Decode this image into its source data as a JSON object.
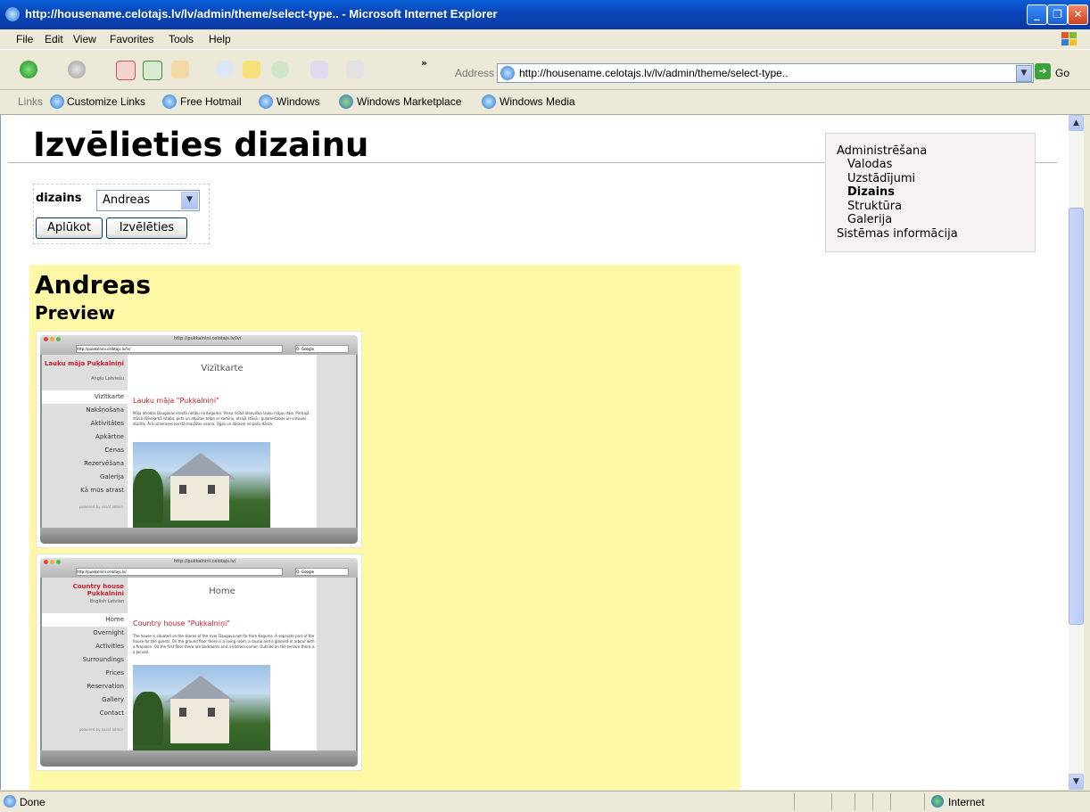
{
  "window": {
    "title": "http://housename.celotajs.lv/lv/admin/theme/select-type.. - Microsoft Internet Explorer"
  },
  "menu": {
    "items": [
      "File",
      "Edit",
      "View",
      "Favorites",
      "Tools",
      "Help"
    ]
  },
  "toolbar": {
    "address_label": "Address",
    "url": "http://housename.celotajs.lv/lv/admin/theme/select-type..",
    "go_label": "Go"
  },
  "links_bar": {
    "label": "Links",
    "items": [
      "Customize Links",
      "Free Hotmail",
      "Windows",
      "Windows Marketplace",
      "Windows Media"
    ]
  },
  "page": {
    "title": "Izvēlieties dizainu",
    "form": {
      "label": "dizains",
      "selected": "Andreas",
      "apply_label": "Aplūkot",
      "choose_label": "Izvēlēties"
    },
    "sidenav": {
      "items": [
        "Administrēšana",
        "Valodas",
        "Uzstādījumi",
        "Dizains",
        "Struktūra",
        "Galerija",
        "Sistēmas informācija"
      ],
      "active": "Dizains"
    },
    "theme": {
      "name": "Andreas",
      "preview_label": "Preview",
      "previews": [
        {
          "browser_url": "http://pukkalnini.celotajs.lv/lv/",
          "address": "http://pukkalnini.celotajs.lv/lv/",
          "search_placeholder": "Q- Google",
          "brand": "Lauku māja Puķkalniņi",
          "langs": "Angļu  Latviešu",
          "nav": [
            "Vizītkarte",
            "Nakšņošana",
            "Aktivitātes",
            "Apkārtne",
            "Cenas",
            "Rezervēšana",
            "Galerija",
            "Kā mūs atrast"
          ],
          "powered": "powered by sosof admin",
          "page_title": "Vizītkarte",
          "heading": "Lauku māja \"Puķkalniņi\"",
          "body": "Māja atrodas Daugavas krastā netālu no Ķeguma. Viesu rīcībā atsevišķa lauku mājas daļa. Pirmajā stāvā dzīvojamā istaba, pirts un atpūtas telpa ar kamīnu, otrajā stāvā - guļamistabas un virtuves stūrītis. Ārā uz terases karstā masāžas vanna. Ogas un dārzeņi no pašu dārza."
        },
        {
          "browser_url": "http://pukkalnini.celotajs.lv/",
          "address": "http://pukkalnini.celotajs.lv/",
          "search_placeholder": "Q- Google",
          "brand": "Country house Pukkalnini",
          "langs": "English  Latvian",
          "nav": [
            "Home",
            "Overnight",
            "Activities",
            "Surroundings",
            "Prices",
            "Reservation",
            "Gallery",
            "Contact"
          ],
          "powered": "powered by sosof admin",
          "page_title": "Home",
          "heading": "Country house \"Puķkalniņi\"",
          "body": "The house is situated on the shores of the river Daugava not far from Ķegums. A separate part of the house for the guests. On the ground floor there is a living room, a sauna and a glassed-in arbour with a fireplace. On the first floor there are bedrooms and a kitchen corner. Outside on the terrace there is a Jacuzzi."
        }
      ]
    }
  },
  "status": {
    "text": "Done",
    "zone": "Internet"
  }
}
